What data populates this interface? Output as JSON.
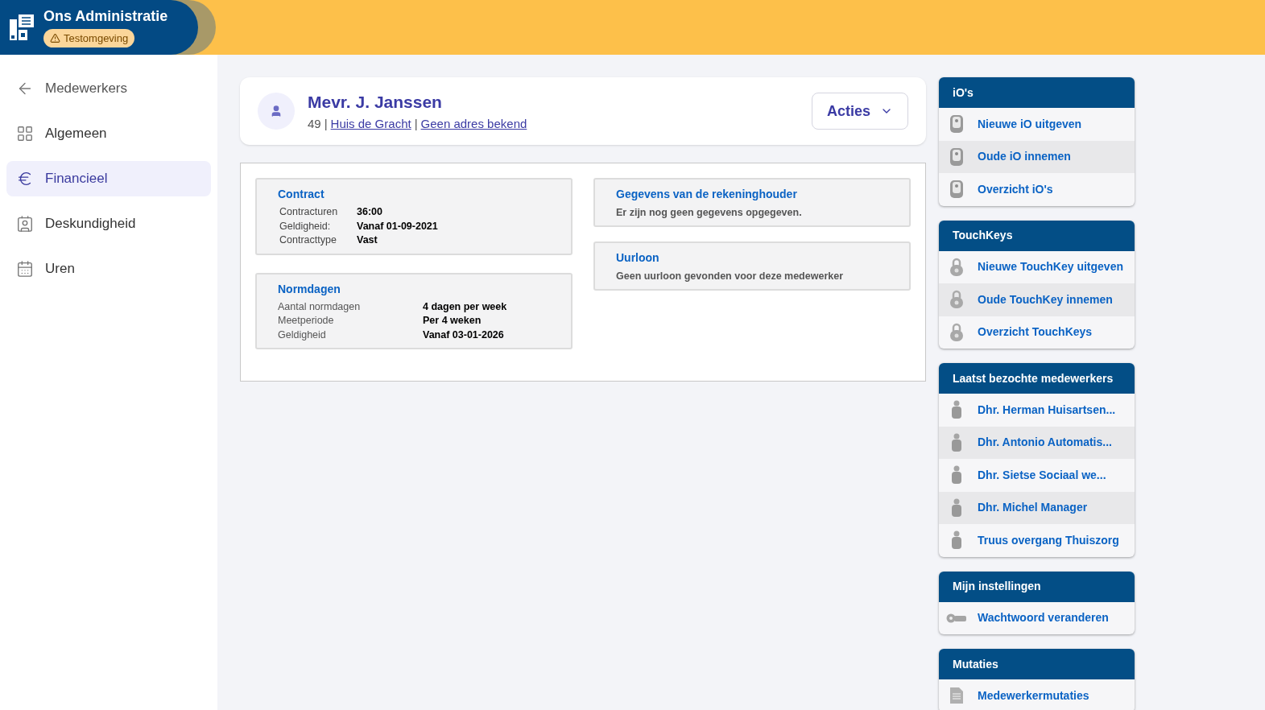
{
  "app": {
    "title": "Ons Administratie",
    "badge": "Testomgeving"
  },
  "sidebar": {
    "items": [
      {
        "kind": "back",
        "label": "Medewerkers",
        "selected": false
      },
      {
        "kind": "grid",
        "label": "Algemeen",
        "selected": false
      },
      {
        "kind": "euro",
        "label": "Financieel",
        "selected": true
      },
      {
        "kind": "badge",
        "label": "Deskundigheid",
        "selected": false
      },
      {
        "kind": "calendar",
        "label": "Uren",
        "selected": false
      }
    ]
  },
  "employee": {
    "name": "Mevr. J. Janssen",
    "number": "49",
    "separator": "|",
    "location": "Huis de Gracht",
    "address": "Geen adres bekend",
    "actions_button": "Acties"
  },
  "cards_left": [
    {
      "title": "Contract",
      "kind": "compact",
      "rows": [
        {
          "label": "Contracturen",
          "value": "36:00"
        },
        {
          "label": "Geldigheid:",
          "value": "Vanaf 01-09-2021"
        },
        {
          "label": "Contracttype",
          "value": "Vast"
        }
      ]
    },
    {
      "title": "Normdagen",
      "kind": "wide",
      "rows": [
        {
          "label": "Aantal normdagen",
          "value": "4 dagen per week"
        },
        {
          "label": "Meetperiode",
          "value": "Per 4 weken"
        },
        {
          "label": "Geldigheid",
          "value": "Vanaf 03-01-2026"
        }
      ]
    }
  ],
  "cards_right": [
    {
      "title": "Gegevens van de rekeninghouder",
      "text": "Er zijn nog geen gegevens opgegeven."
    },
    {
      "title": "Uurloon",
      "text": "Geen uurloon gevonden voor deze medewerker"
    }
  ],
  "panels": [
    {
      "title": "iO's",
      "items": [
        {
          "kind": "io",
          "label": "Nieuwe iO uitgeven"
        },
        {
          "kind": "io",
          "label": "Oude iO innemen"
        },
        {
          "kind": "io",
          "label": "Overzicht iO's"
        }
      ]
    },
    {
      "title": "TouchKeys",
      "items": [
        {
          "kind": "touchkey",
          "label": "Nieuwe TouchKey uitgeven"
        },
        {
          "kind": "touchkey",
          "label": "Oude TouchKey innemen"
        },
        {
          "kind": "touchkey",
          "label": "Overzicht TouchKeys"
        }
      ]
    },
    {
      "title": "Laatst bezochte medewerkers",
      "items": [
        {
          "kind": "person",
          "label": "Dhr. Herman Huisartsen..."
        },
        {
          "kind": "person",
          "label": "Dhr. Antonio Automatis..."
        },
        {
          "kind": "person",
          "label": "Dhr. Sietse Sociaal we..."
        },
        {
          "kind": "person",
          "label": "Dhr. Michel Manager"
        },
        {
          "kind": "person",
          "label": "Truus overgang Thuiszorg"
        }
      ]
    },
    {
      "title": "Mijn instellingen",
      "items": [
        {
          "kind": "key",
          "label": "Wachtwoord veranderen"
        }
      ]
    },
    {
      "title": "Mutaties",
      "items": [
        {
          "kind": "document",
          "label": "Medewerkermutaties"
        }
      ]
    }
  ]
}
